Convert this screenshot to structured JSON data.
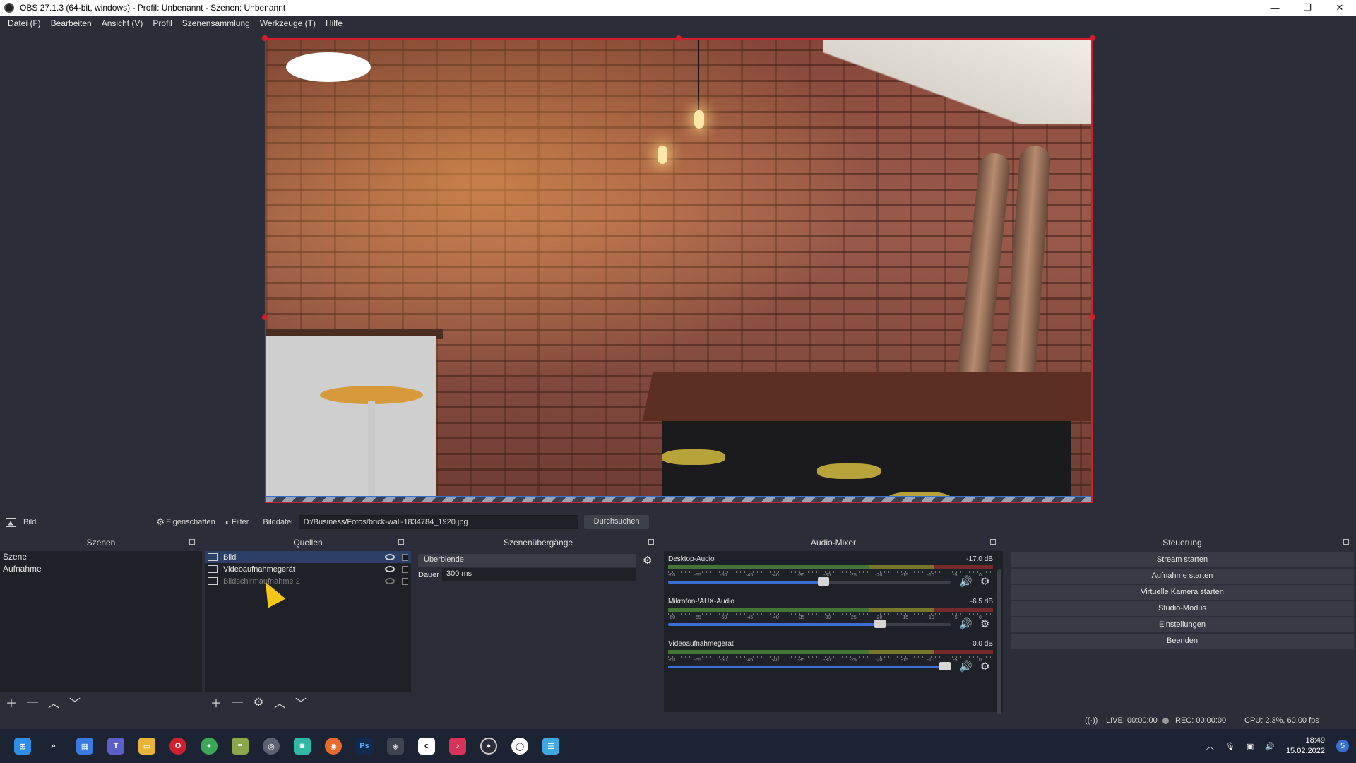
{
  "window": {
    "title": "OBS 27.1.3 (64-bit, windows) - Profil: Unbenannt - Szenen: Unbenannt",
    "minimize": "—",
    "maximize": "❐",
    "close": "✕"
  },
  "menu": [
    "Datei (F)",
    "Bearbeiten",
    "Ansicht (V)",
    "Profil",
    "Szenensammlung",
    "Werkzeuge (T)",
    "Hilfe"
  ],
  "source_toolbar": {
    "source_name": "Bild",
    "properties_label": "Eigenschaften",
    "filter_label": "Filter",
    "file_label": "Bilddatei",
    "file_path": "D:/Business/Fotos/brick-wall-1834784_1920.jpg",
    "browse_label": "Durchsuchen"
  },
  "scenes": {
    "title": "Szenen",
    "items": [
      "Szene",
      "Aufnahme"
    ]
  },
  "sources": {
    "title": "Quellen",
    "items": [
      {
        "name": "Bild",
        "selected": true,
        "visible": true
      },
      {
        "name": "Videoaufnahmegerät",
        "selected": false,
        "visible": true
      },
      {
        "name": "Bildschirmaufnahme 2",
        "selected": false,
        "visible": false
      }
    ]
  },
  "transitions": {
    "title": "Szenenübergänge",
    "selected": "Überblende",
    "duration_label": "Dauer",
    "duration_value": "300 ms"
  },
  "mixer": {
    "title": "Audio-Mixer",
    "tick_labels": [
      "-60",
      "-55",
      "-50",
      "-45",
      "-40",
      "-35",
      "-30",
      "-25",
      "-20",
      "-15",
      "-10",
      "-5",
      "0"
    ],
    "channels": [
      {
        "name": "Desktop-Audio",
        "db": "-17.0 dB",
        "level": 0.55
      },
      {
        "name": "Mikrofon-/AUX-Audio",
        "db": "-6.5 dB",
        "level": 0.75
      },
      {
        "name": "Videoaufnahmegerät",
        "db": "0.0 dB",
        "level": 1.0
      }
    ]
  },
  "controls": {
    "title": "Steuerung",
    "buttons": [
      "Stream starten",
      "Aufnahme starten",
      "Virtuelle Kamera starten",
      "Studio-Modus",
      "Einstellungen",
      "Beenden"
    ]
  },
  "status": {
    "live": "LIVE: 00:00:00",
    "rec": "REC: 00:00:00",
    "cpu": "CPU: 2.3%, 60.00 fps"
  },
  "taskbar": {
    "time": "18:49",
    "date": "15.02.2022",
    "notification_count": "5",
    "apps": [
      "start-icon",
      "search-icon",
      "widgets-icon",
      "teams-icon",
      "explorer-icon",
      "opera-icon",
      "chrome-icon",
      "layers-icon",
      "steam-icon",
      "app-icon",
      "firefox-icon",
      "photoshop-icon",
      "davinci-icon",
      "cricut-icon",
      "music-icon",
      "obs-icon",
      "camera-icon",
      "notepad-icon"
    ],
    "ps_label": "Ps"
  },
  "colors": {
    "selection_border": "#d0202d",
    "accent": "#3a6fd4",
    "background": "#2b2e38"
  }
}
